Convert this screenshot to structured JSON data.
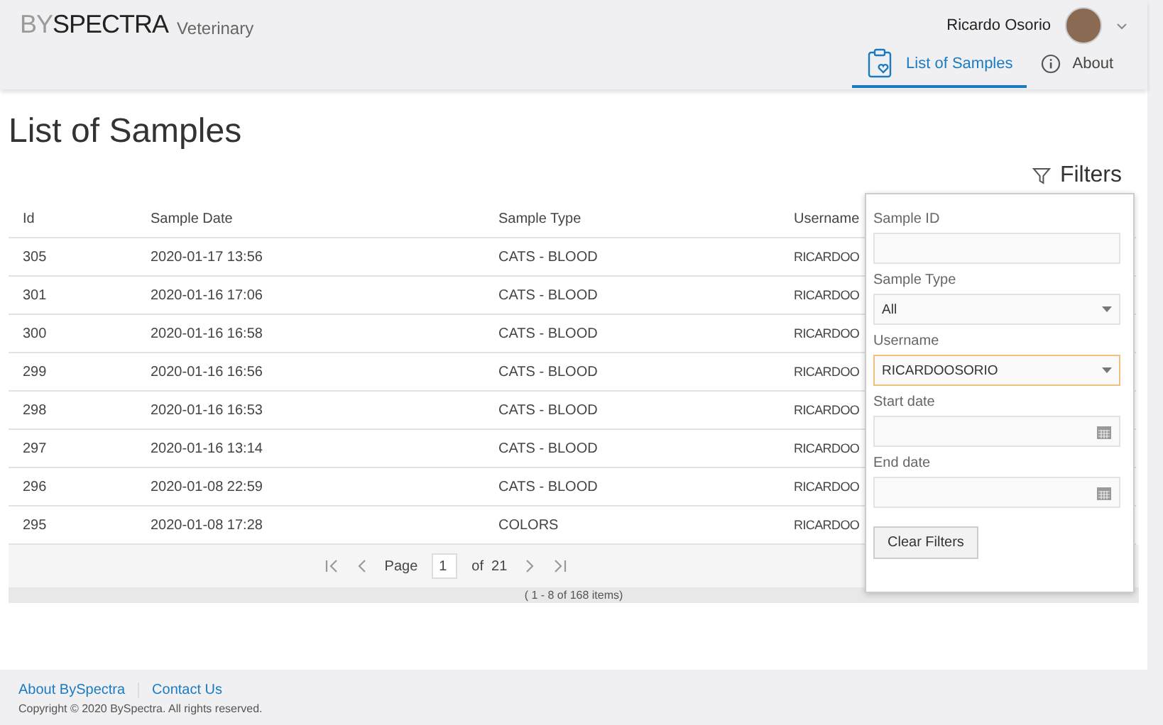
{
  "brand": {
    "logo_light": "BY",
    "logo_dark": "SPECTRA",
    "subtitle": "Veterinary"
  },
  "user": {
    "name": "Ricardo Osorio"
  },
  "nav_tabs": [
    {
      "label": "List of Samples",
      "selected": true
    },
    {
      "label": "About",
      "selected": false
    }
  ],
  "page_title": "List of Samples",
  "filters_toggle": "Filters",
  "table": {
    "columns": [
      "Id",
      "Sample Date",
      "Sample Type",
      "Username"
    ],
    "rows": [
      [
        "305",
        "2020-01-17 13:56",
        "CATS - BLOOD",
        "RICARDOO"
      ],
      [
        "301",
        "2020-01-16 17:06",
        "CATS - BLOOD",
        "RICARDOO"
      ],
      [
        "300",
        "2020-01-16 16:58",
        "CATS - BLOOD",
        "RICARDOO"
      ],
      [
        "299",
        "2020-01-16 16:56",
        "CATS - BLOOD",
        "RICARDOO"
      ],
      [
        "298",
        "2020-01-16 16:53",
        "CATS - BLOOD",
        "RICARDOO"
      ],
      [
        "297",
        "2020-01-16 13:14",
        "CATS - BLOOD",
        "RICARDOO"
      ],
      [
        "296",
        "2020-01-08 22:59",
        "CATS - BLOOD",
        "RICARDOO"
      ],
      [
        "295",
        "2020-01-08 17:28",
        "COLORS",
        "RICARDOO"
      ]
    ]
  },
  "pager": {
    "page_label": "Page",
    "page": "1",
    "of_label": "of",
    "total_pages": "21",
    "summary": "( 1 - 8 of 168 items)"
  },
  "filter_panel": {
    "fields": [
      {
        "kind": "text",
        "label": "Sample ID"
      },
      {
        "kind": "select",
        "label": "Sample Type",
        "value": "All",
        "focused": false
      },
      {
        "kind": "select",
        "label": "Username",
        "value": "RICARDOOSORIO",
        "focused": true
      },
      {
        "kind": "date",
        "label": "Start date"
      },
      {
        "kind": "date",
        "label": "End date"
      }
    ],
    "button": "Clear Filters"
  },
  "footer": {
    "links": [
      "About BySpectra",
      "Contact Us"
    ],
    "copyright": "Copyright © 2020 BySpectra. All rights reserved."
  }
}
